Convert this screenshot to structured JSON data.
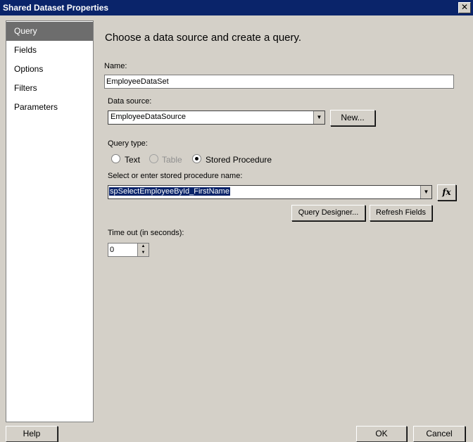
{
  "window": {
    "title": "Shared Dataset Properties",
    "close_label": "✕"
  },
  "sidebar": {
    "items": [
      {
        "label": "Query",
        "active": true
      },
      {
        "label": "Fields"
      },
      {
        "label": "Options"
      },
      {
        "label": "Filters"
      },
      {
        "label": "Parameters"
      }
    ]
  },
  "main": {
    "heading": "Choose a data source and create a query.",
    "name": {
      "label": "Name:",
      "value": "EmployeeDataSet"
    },
    "data_source": {
      "label": "Data source:",
      "value": "EmployeeDataSource",
      "new_button": "New..."
    },
    "query_type": {
      "label": "Query type:",
      "options": [
        {
          "label": "Text",
          "selected": false,
          "enabled": true
        },
        {
          "label": "Table",
          "selected": false,
          "enabled": false
        },
        {
          "label": "Stored Procedure",
          "selected": true,
          "enabled": true
        }
      ]
    },
    "stored_procedure": {
      "label": "Select or enter stored procedure name:",
      "value": "spSelectEmployeeById_FirstName",
      "fx_label": "fx"
    },
    "buttons": {
      "query_designer": "Query Designer...",
      "refresh_fields": "Refresh Fields"
    },
    "timeout": {
      "label": "Time out (in seconds):",
      "value": "0"
    }
  },
  "footer": {
    "help": "Help",
    "ok": "OK",
    "cancel": "Cancel"
  }
}
